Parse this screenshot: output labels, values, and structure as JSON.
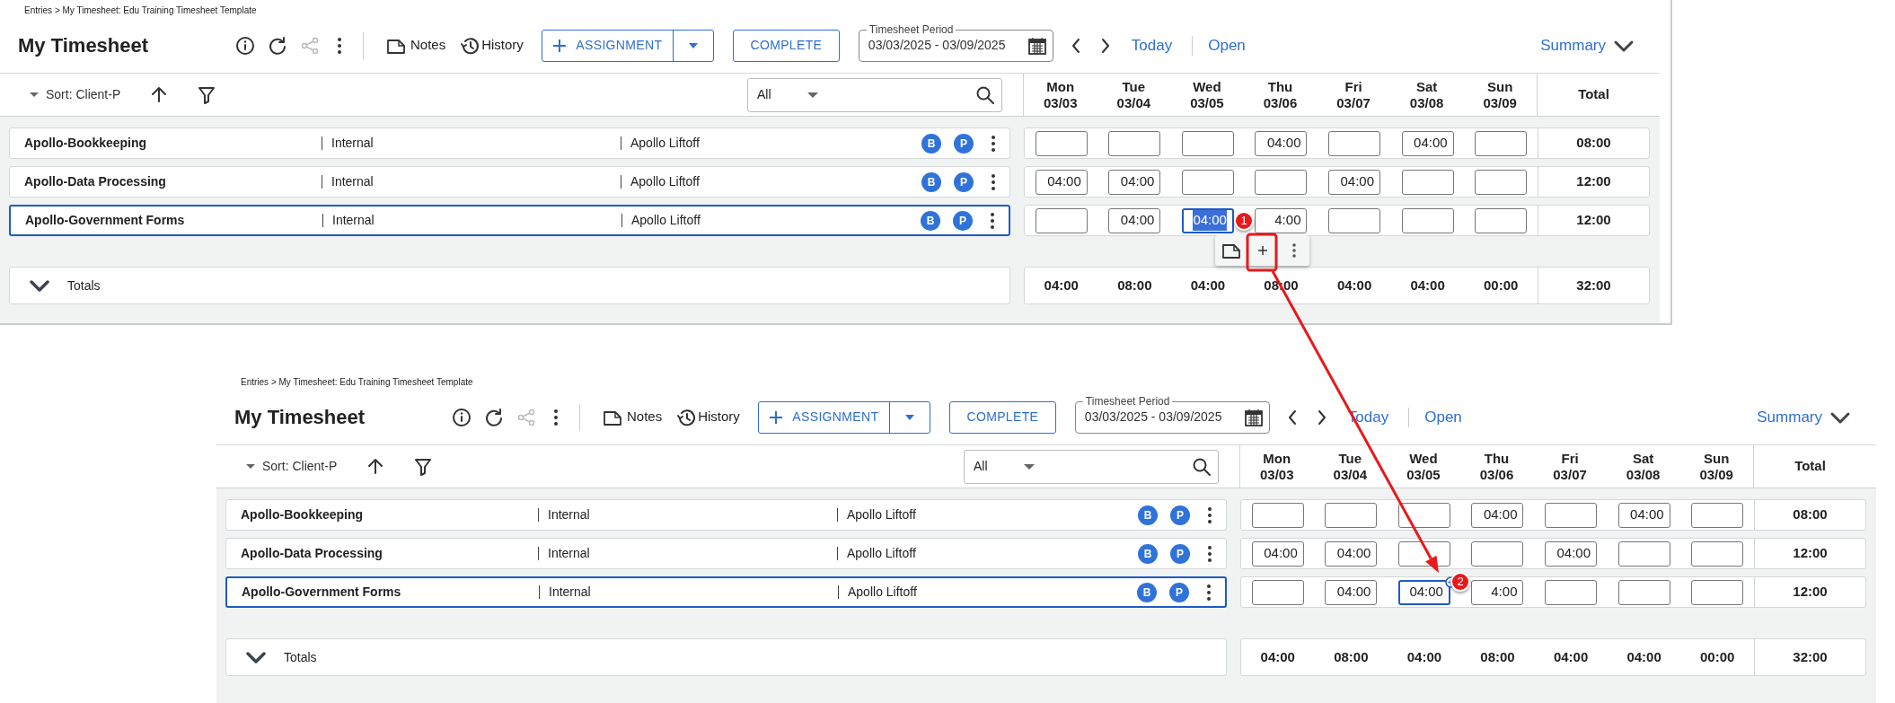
{
  "panels": [
    {
      "breadcrumb": "Entries > My Timesheet: Edu Training Timesheet Template",
      "title": "My Timesheet",
      "notes_label": "Notes",
      "history_label": "History",
      "assignment_label": "ASSIGNMENT",
      "complete_label": "COMPLETE",
      "period_label": "Timesheet Period",
      "period_value": "03/03/2025 - 03/09/2025",
      "today_label": "Today",
      "open_label": "Open",
      "summary_label": "Summary",
      "sort_label": "Sort: Client-P",
      "filter_value": "All",
      "days": [
        {
          "day": "Mon",
          "date": "03/03"
        },
        {
          "day": "Tue",
          "date": "03/04"
        },
        {
          "day": "Wed",
          "date": "03/05"
        },
        {
          "day": "Thu",
          "date": "03/06"
        },
        {
          "day": "Fri",
          "date": "03/07"
        },
        {
          "day": "Sat",
          "date": "03/08"
        },
        {
          "day": "Sun",
          "date": "03/09"
        }
      ],
      "total_header": "Total",
      "rows": [
        {
          "name": "Apollo-Bookkeeping",
          "type": "Internal",
          "project": "Apollo Liftoff",
          "badges": [
            "B",
            "P"
          ],
          "selected": false,
          "total": "08:00",
          "cells": [
            {
              "focused": false
            },
            {
              "focused": false
            },
            {
              "focused": false
            },
            {
              "value": "04:00",
              "focused": false
            },
            {
              "focused": false
            },
            {
              "value": "04:00",
              "focused": false
            },
            {
              "focused": false
            }
          ]
        },
        {
          "name": "Apollo-Data Processing",
          "type": "Internal",
          "project": "Apollo Liftoff",
          "badges": [
            "B",
            "P"
          ],
          "selected": false,
          "total": "12:00",
          "cells": [
            {
              "value": "04:00",
              "focused": false
            },
            {
              "value": "04:00",
              "focused": false
            },
            {
              "focused": false
            },
            {
              "focused": false
            },
            {
              "value": "04:00",
              "focused": false
            },
            {
              "focused": false
            },
            {
              "focused": false
            }
          ]
        },
        {
          "name": "Apollo-Government Forms",
          "type": "Internal",
          "project": "Apollo Liftoff",
          "badges": [
            "B",
            "P"
          ],
          "selected": true,
          "total": "12:00",
          "cells": [
            {
              "focused": false
            },
            {
              "value": "04:00",
              "focused": false
            },
            {
              "value": "04:00",
              "focused": true,
              "text_selected": true
            },
            {
              "value": "4:00",
              "focused": false
            },
            {
              "focused": false
            },
            {
              "focused": false
            },
            {
              "focused": false
            }
          ]
        }
      ],
      "totals_label": "Totals",
      "totals": [
        "04:00",
        "08:00",
        "04:00",
        "08:00",
        "04:00",
        "04:00",
        "00:00"
      ],
      "grand_total": "32:00",
      "cell_toolbar_open": true
    },
    {
      "breadcrumb": "Entries > My Timesheet: Edu Training Timesheet Template",
      "title": "My Timesheet",
      "notes_label": "Notes",
      "history_label": "History",
      "assignment_label": "ASSIGNMENT",
      "complete_label": "COMPLETE",
      "period_label": "Timesheet Period",
      "period_value": "03/03/2025 - 03/09/2025",
      "today_label": "Today",
      "open_label": "Open",
      "summary_label": "Summary",
      "sort_label": "Sort: Client-P",
      "filter_value": "All",
      "days": [
        {
          "day": "Mon",
          "date": "03/03"
        },
        {
          "day": "Tue",
          "date": "03/04"
        },
        {
          "day": "Wed",
          "date": "03/05"
        },
        {
          "day": "Thu",
          "date": "03/06"
        },
        {
          "day": "Fri",
          "date": "03/07"
        },
        {
          "day": "Sat",
          "date": "03/08"
        },
        {
          "day": "Sun",
          "date": "03/09"
        }
      ],
      "total_header": "Total",
      "rows": [
        {
          "name": "Apollo-Bookkeeping",
          "type": "Internal",
          "project": "Apollo Liftoff",
          "badges": [
            "B",
            "P"
          ],
          "selected": false,
          "total": "08:00",
          "cells": [
            {
              "focused": false
            },
            {
              "focused": false
            },
            {
              "focused": false
            },
            {
              "value": "04:00",
              "focused": false
            },
            {
              "focused": false
            },
            {
              "value": "04:00",
              "focused": false
            },
            {
              "focused": false
            }
          ]
        },
        {
          "name": "Apollo-Data Processing",
          "type": "Internal",
          "project": "Apollo Liftoff",
          "badges": [
            "B",
            "P"
          ],
          "selected": false,
          "total": "12:00",
          "cells": [
            {
              "value": "04:00",
              "focused": false
            },
            {
              "value": "04:00",
              "focused": false
            },
            {
              "focused": false
            },
            {
              "focused": false
            },
            {
              "value": "04:00",
              "focused": false
            },
            {
              "focused": false
            },
            {
              "focused": false
            }
          ]
        },
        {
          "name": "Apollo-Government Forms",
          "type": "Internal",
          "project": "Apollo Liftoff",
          "badges": [
            "B",
            "P"
          ],
          "selected": true,
          "total": "12:00",
          "cells": [
            {
              "focused": false
            },
            {
              "value": "04:00",
              "focused": false
            },
            {
              "value": "04:00",
              "focused": true,
              "text_selected": false
            },
            {
              "value": "4:00",
              "focused": false
            },
            {
              "focused": false
            },
            {
              "focused": false
            },
            {
              "focused": false
            }
          ]
        }
      ],
      "totals_label": "Totals",
      "totals": [
        "04:00",
        "08:00",
        "04:00",
        "08:00",
        "04:00",
        "04:00",
        "00:00"
      ],
      "grand_total": "32:00",
      "cell_toolbar_open": false
    }
  ],
  "annotations": [
    {
      "label": "1"
    },
    {
      "label": "2"
    }
  ]
}
